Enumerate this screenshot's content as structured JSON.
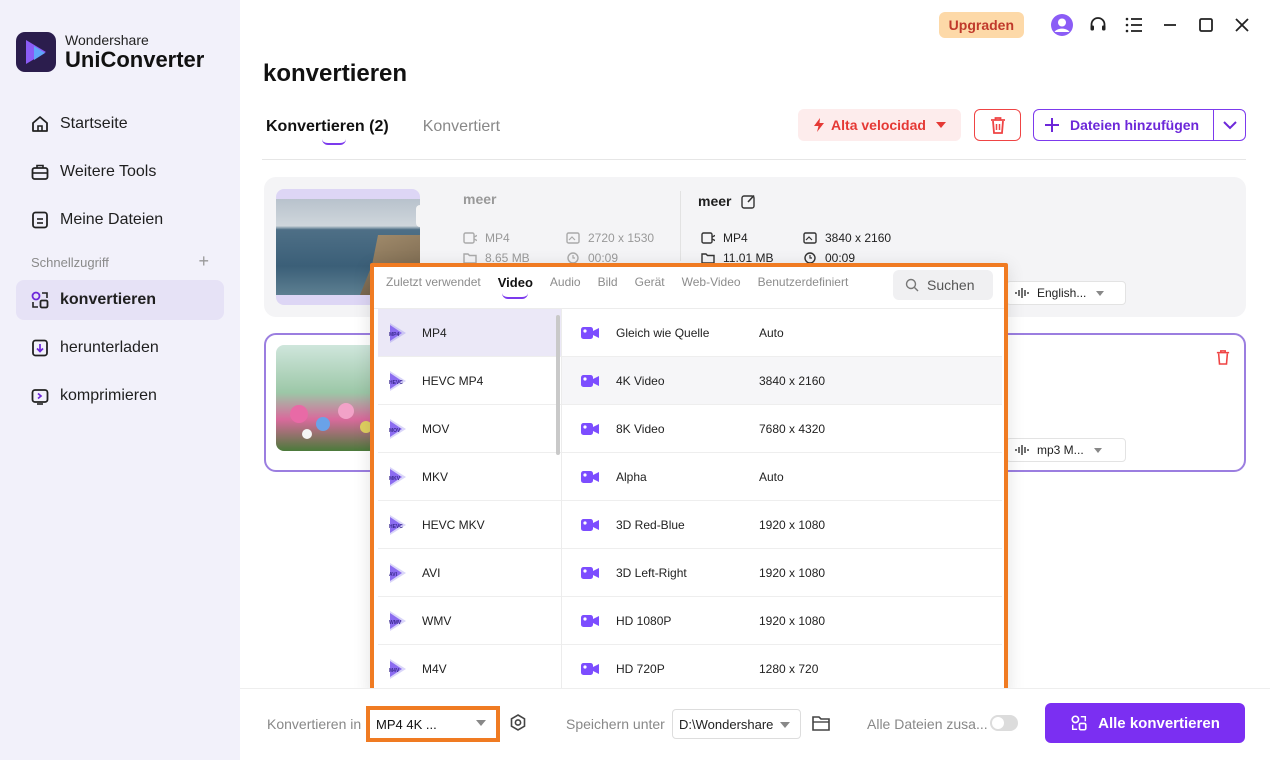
{
  "app": {
    "brand_sub": "Wondershare",
    "brand_main": "UniConverter"
  },
  "window": {
    "upgrade_label": "Upgraden"
  },
  "sidebar": {
    "items": [
      {
        "label": "Startseite",
        "icon": "home-icon"
      },
      {
        "label": "Weitere Tools",
        "icon": "toolbox-icon"
      },
      {
        "label": "Meine Dateien",
        "icon": "files-icon"
      }
    ],
    "quick_access_label": "Schnellzugriff",
    "quick_items": [
      {
        "label": "konvertieren",
        "icon": "convert-icon",
        "active": true
      },
      {
        "label": "herunterladen",
        "icon": "download-icon"
      },
      {
        "label": "komprimieren",
        "icon": "compress-icon"
      }
    ]
  },
  "main": {
    "title": "konvertieren",
    "tabs": [
      {
        "label": "Konvertieren (2)",
        "active": true
      },
      {
        "label": "Konvertiert"
      }
    ],
    "speed_label": "Alta velocidad",
    "add_files_label": "Dateien hinzufügen"
  },
  "files": [
    {
      "source": {
        "name": "meer",
        "format": "MP4",
        "resolution": "2720 x 1530",
        "size": "8.65 MB",
        "duration": "00:09"
      },
      "target": {
        "name": "meer",
        "format": "MP4",
        "resolution": "3840 x 2160",
        "size": "11.01 MB",
        "duration": "00:09"
      },
      "audio": "English..."
    },
    {
      "audio": "mp3 M..."
    }
  ],
  "format_popup": {
    "tabs": [
      "Zuletzt verwendet",
      "Video",
      "Audio",
      "Bild",
      "Gerät",
      "Web-Video",
      "Benutzerdefiniert"
    ],
    "active_tab": "Video",
    "search_placeholder": "Suchen",
    "formats": [
      {
        "label": "MP4",
        "badge": "MP4",
        "selected": true
      },
      {
        "label": "HEVC MP4",
        "badge": "HEVC"
      },
      {
        "label": "MOV",
        "badge": "MOV"
      },
      {
        "label": "MKV",
        "badge": "MKV"
      },
      {
        "label": "HEVC MKV",
        "badge": "HEVC"
      },
      {
        "label": "AVI",
        "badge": "AVI"
      },
      {
        "label": "WMV",
        "badge": "WMV"
      },
      {
        "label": "M4V",
        "badge": "M4V"
      }
    ],
    "qualities": [
      {
        "name": "Gleich wie Quelle",
        "resolution": "Auto"
      },
      {
        "name": "4K Video",
        "resolution": "3840 x 2160"
      },
      {
        "name": "8K Video",
        "resolution": "7680 x 4320"
      },
      {
        "name": "Alpha",
        "resolution": "Auto"
      },
      {
        "name": "3D Red-Blue",
        "resolution": "1920 x 1080"
      },
      {
        "name": "3D Left-Right",
        "resolution": "1920 x 1080"
      },
      {
        "name": "HD 1080P",
        "resolution": "1920 x 1080"
      },
      {
        "name": "HD 720P",
        "resolution": "1280 x 720"
      }
    ]
  },
  "bottom_bar": {
    "convert_to_label": "Konvertieren in",
    "convert_to_value": "MP4 4K ...",
    "save_to_label": "Speichern unter",
    "save_path": "D:\\Wondershare",
    "merge_label": "Alle Dateien zusa...",
    "convert_all_label": "Alle konvertieren"
  },
  "colors": {
    "accent": "#7b2ff2",
    "highlight_border": "#f07b22",
    "speed_red": "#e53935"
  }
}
